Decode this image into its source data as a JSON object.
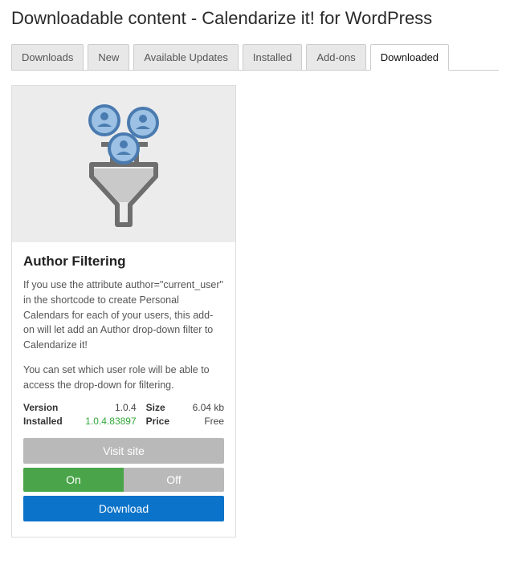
{
  "page": {
    "title": "Downloadable content - Calendarize it! for WordPress"
  },
  "tabs": [
    {
      "label": "Downloads"
    },
    {
      "label": "New"
    },
    {
      "label": "Available Updates"
    },
    {
      "label": "Installed"
    },
    {
      "label": "Add-ons"
    },
    {
      "label": "Downloaded",
      "active": true
    }
  ],
  "card": {
    "title": "Author Filtering",
    "desc1": "If you use the attribute author=\"current_user\" in the shortcode to create Personal Calendars for each of your users, this add-on will let add an Author drop-down filter to Calendarize it!",
    "desc2": "You can set which user role will be able to access the drop-down for filtering.",
    "meta": {
      "version_label": "Version",
      "version_value": "1.0.4",
      "size_label": "Size",
      "size_value": "6.04 kb",
      "installed_label": "Installed",
      "installed_value": "1.0.4.83897",
      "price_label": "Price",
      "price_value": "Free"
    },
    "buttons": {
      "visit": "Visit site",
      "on": "On",
      "off": "Off",
      "download": "Download"
    }
  }
}
